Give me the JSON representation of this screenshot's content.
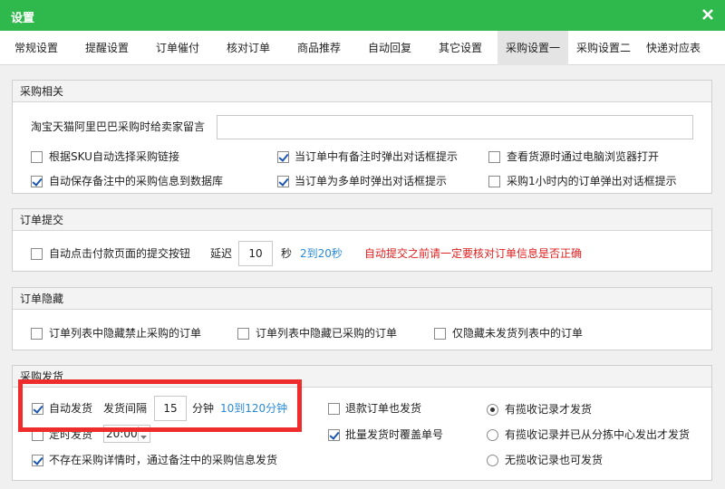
{
  "window": {
    "title": "设置"
  },
  "tabs": [
    {
      "label": "常规设置"
    },
    {
      "label": "提醒设置"
    },
    {
      "label": "订单催付"
    },
    {
      "label": "核对订单"
    },
    {
      "label": "商品推荐"
    },
    {
      "label": "自动回复"
    },
    {
      "label": "其它设置"
    },
    {
      "label": "采购设置一",
      "active": true
    },
    {
      "label": "采购设置二"
    },
    {
      "label": "快递对应表"
    }
  ],
  "purchase_related": {
    "heading": "采购相关",
    "message_label": "淘宝天猫阿里巴巴采购时给卖家留言",
    "message_value": "",
    "options": [
      {
        "label": "根据SKU自动选择采购链接",
        "checked": false
      },
      {
        "label": "当订单中有备注时弹出对话框提示",
        "checked": true
      },
      {
        "label": "查看货源时通过电脑浏览器打开",
        "checked": false
      },
      {
        "label": "自动保存备注中的采购信息到数据库",
        "checked": true
      },
      {
        "label": "当订单为多单时弹出对话框提示",
        "checked": true
      },
      {
        "label": "采购1小时内的订单弹出对话框提示",
        "checked": false
      }
    ]
  },
  "order_submit": {
    "heading": "订单提交",
    "auto_click_label": "自动点击付款页面的提交按钮",
    "auto_click_checked": false,
    "delay_label": "延迟",
    "delay_value": "10",
    "delay_unit": "秒",
    "delay_range": "2到20秒",
    "warning": "自动提交之前请一定要核对订单信息是否正确"
  },
  "order_hide": {
    "heading": "订单隐藏",
    "options": [
      {
        "label": "订单列表中隐藏禁止采购的订单",
        "checked": false
      },
      {
        "label": "订单列表中隐藏已采购的订单",
        "checked": false
      },
      {
        "label": "仅隐藏未发货列表中的订单",
        "checked": false
      }
    ]
  },
  "purchase_ship": {
    "heading": "采购发货",
    "auto_ship_label": "自动发货",
    "auto_ship_checked": true,
    "interval_label": "发货间隔",
    "interval_value": "15",
    "interval_unit": "分钟",
    "interval_range": "10到120分钟",
    "timed_label": "定时发货",
    "timed_checked": false,
    "timed_value": "20:00",
    "fallback_label": "不存在采购详情时，通过备注中的采购信息发货",
    "fallback_checked": true,
    "refund_label": "退款订单也发货",
    "refund_checked": false,
    "overwrite_label": "批量发货时覆盖单号",
    "overwrite_checked": true,
    "radios": [
      {
        "label": "有揽收记录才发货",
        "checked": true
      },
      {
        "label": "有揽收记录并已从分拣中心发出才发货",
        "checked": false
      },
      {
        "label": "无揽收记录也可发货",
        "checked": false
      }
    ]
  },
  "colors": {
    "titlebar": "#2fb94c",
    "highlight_box": "#ee2c2c",
    "hint_blue": "#2a8ad6",
    "warning_red": "#e02020"
  }
}
